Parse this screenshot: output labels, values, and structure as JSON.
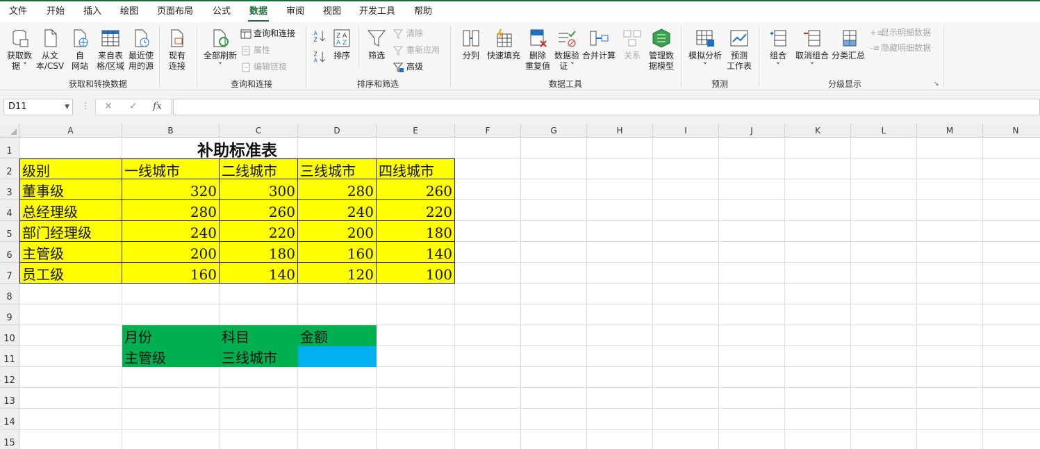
{
  "menu": {
    "tabs": [
      "文件",
      "开始",
      "插入",
      "绘图",
      "页面布局",
      "公式",
      "数据",
      "审阅",
      "视图",
      "开发工具",
      "帮助"
    ],
    "active": "数据"
  },
  "ribbon": {
    "groups": {
      "get_transform": "获取和转换数据",
      "query": "查询和连接",
      "sort_filter": "排序和筛选",
      "data_tools": "数据工具",
      "forecast": "预测",
      "outline": "分级显示"
    },
    "buttons": {
      "get_data": "获取数\n据 ˅",
      "from_csv": "从文\n本/CSV",
      "from_web": "自\n网站",
      "from_table": "来自表\n格/区域",
      "recent": "最近使\n用的源",
      "existing": "现有\n连接",
      "refresh_all": "全部刷新\n˅",
      "query_conn": "查询和连接",
      "properties": "属性",
      "edit_links": "编辑链接",
      "sort": "排序",
      "filter": "筛选",
      "clear": "清除",
      "reapply": "重新应用",
      "advanced": "高级",
      "split": "分列",
      "flash_fill": "快速填充",
      "remove_dup": "删除\n重复值",
      "validation": "数据验\n证 ˅",
      "consolidate": "合并计算",
      "relations": "关系",
      "data_model": "管理数\n据模型",
      "what_if": "模拟分析\n˅",
      "forecast_sheet": "预测\n工作表",
      "group": "组合\n˅",
      "ungroup": "取消组合\n˅",
      "subtotal": "分类汇总",
      "show_detail": "显示明细数据",
      "hide_detail": "隐藏明细数据"
    }
  },
  "formula_bar": {
    "name_box": "D11",
    "fx": "fx",
    "formula": ""
  },
  "columns": [
    "A",
    "B",
    "C",
    "D",
    "E",
    "F",
    "G",
    "H",
    "I",
    "J",
    "K",
    "L",
    "M",
    "N"
  ],
  "rows": [
    "1",
    "2",
    "3",
    "4",
    "5",
    "6",
    "7",
    "8",
    "9",
    "10",
    "11",
    "12",
    "13",
    "14",
    "15"
  ],
  "sheet": {
    "title": "补助标准表",
    "header": [
      "级别",
      "一线城市",
      "二线城市",
      "三线城市",
      "四线城市"
    ],
    "table": [
      [
        "董事级",
        "320",
        "300",
        "280",
        "260"
      ],
      [
        "总经理级",
        "280",
        "260",
        "240",
        "220"
      ],
      [
        "部门经理级",
        "240",
        "220",
        "200",
        "180"
      ],
      [
        "主管级",
        "200",
        "180",
        "160",
        "140"
      ],
      [
        "员工级",
        "160",
        "140",
        "120",
        "100"
      ]
    ],
    "lookup_header": [
      "月份",
      "科目",
      "金额"
    ],
    "lookup_values": [
      "主管级",
      "三线城市",
      ""
    ]
  },
  "colors": {
    "accent": "#1e6b3d",
    "table_fill": "#ffff00",
    "lookup_fill": "#00b050",
    "selected_fill": "#00b0f0"
  }
}
